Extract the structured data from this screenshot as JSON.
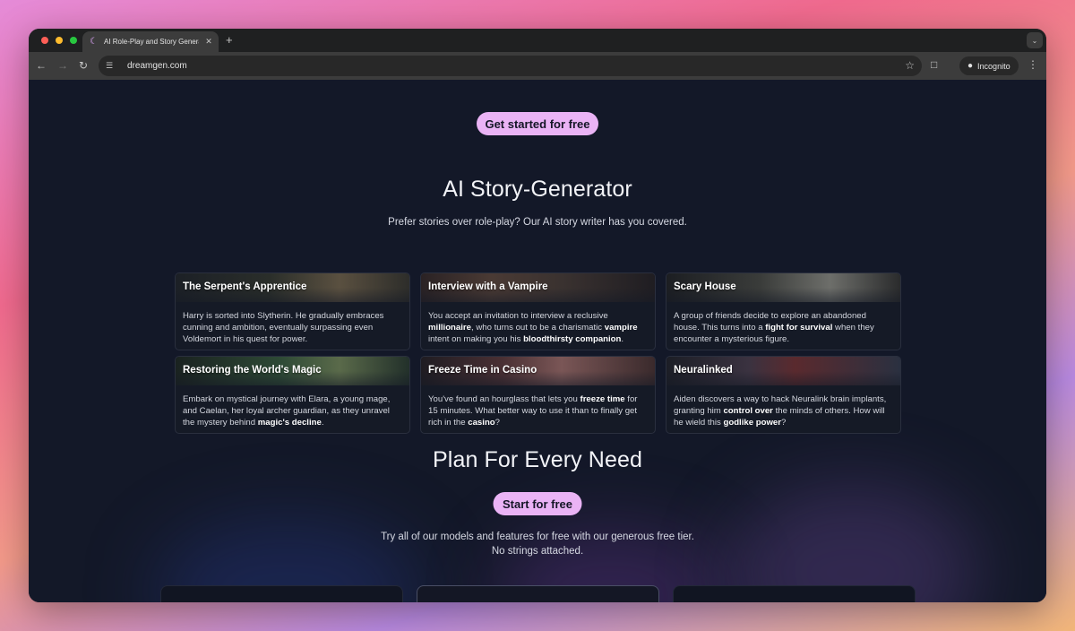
{
  "browser": {
    "tab_title": "AI Role-Play and Story Generator",
    "tab_favicon": "moon-icon",
    "url": "dreamgen.com",
    "incognito_label": "Incognito"
  },
  "hero": {
    "cta_label": "Get started for free"
  },
  "story_section": {
    "heading": "AI Story-Generator",
    "subtitle": "Prefer stories over role-play? Our AI story writer has you covered.",
    "cards": [
      {
        "title": "The Serpent's Apprentice",
        "description": "Harry is sorted into Slytherin. He gradually embraces cunning and ambition, eventually surpassing even Voldemort in his quest for power."
      },
      {
        "title": "Interview with a Vampire",
        "description_parts": [
          "You accept an invitation to interview a reclusive ",
          "millionaire",
          ", who turns out to be a charismatic ",
          "vampire",
          " intent on making you his ",
          "bloodthirsty companion",
          "."
        ]
      },
      {
        "title": "Scary House",
        "description_parts": [
          "A group of friends decide to explore an abandoned house. This turns into a ",
          "fight for survival",
          " when they encounter a mysterious figure."
        ]
      },
      {
        "title": "Restoring the World's Magic",
        "description_parts": [
          "Embark on mystical journey with Elara, a young mage, and Caelan, her loyal archer guardian, as they unravel the mystery behind ",
          "magic's decline",
          "."
        ]
      },
      {
        "title": "Freeze Time in Casino",
        "description_parts": [
          "You've found an hourglass that lets you ",
          "freeze time",
          " for 15 minutes. What better way to use it than to finally get rich in the ",
          "casino",
          "?"
        ]
      },
      {
        "title": "Neuralinked",
        "description_parts": [
          "Aiden discovers a way to hack Neuralink brain implants, granting him ",
          "control over",
          " the minds of others. How will he wield this ",
          "godlike power",
          "?"
        ]
      }
    ]
  },
  "plans_section": {
    "heading": "Plan For Every Need",
    "cta_label": "Start for free",
    "subtitle_line1": "Try all of our models and features for free with our generous free tier.",
    "subtitle_line2": "No strings attached."
  },
  "colors": {
    "page_bg": "#131828",
    "cta_bg": "#eab3f5",
    "cta_text": "#141626"
  }
}
